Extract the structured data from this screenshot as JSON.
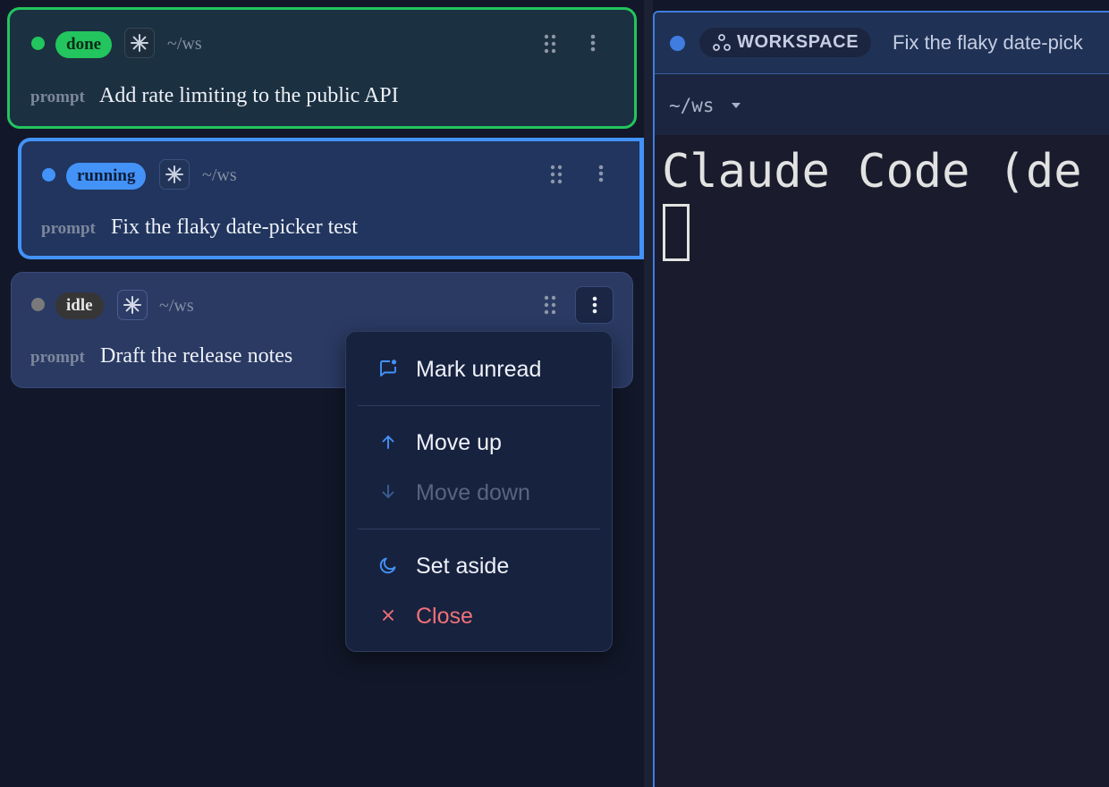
{
  "sessions": [
    {
      "status": "done",
      "path": "~/ws",
      "prompt_label": "prompt",
      "prompt": "Add rate limiting to the public API",
      "status_color": "#22c55e"
    },
    {
      "status": "running",
      "path": "~/ws",
      "prompt_label": "prompt",
      "prompt": "Fix the flaky date-picker test",
      "status_color": "#4392f7"
    },
    {
      "status": "idle",
      "path": "~/ws",
      "prompt_label": "prompt",
      "prompt": "Draft the release notes",
      "status_color": "#7a7a7a"
    }
  ],
  "workspace": {
    "chip_label": "WORKSPACE",
    "title": "Fix the flaky date-pick",
    "path": "~/ws",
    "terminal_text": "Claude Code (de",
    "accent": "#3f7de0"
  },
  "context_menu": {
    "items": [
      {
        "label": "Mark unread",
        "icon": "message-unread-icon",
        "enabled": true
      },
      {
        "label": "Move up",
        "icon": "arrow-up-icon",
        "enabled": true
      },
      {
        "label": "Move down",
        "icon": "arrow-down-icon",
        "enabled": false
      },
      {
        "label": "Set aside",
        "icon": "moon-icon",
        "enabled": true
      },
      {
        "label": "Close",
        "icon": "close-icon",
        "enabled": true,
        "danger": true
      }
    ],
    "danger_color": "#f07178",
    "icon_color": "#4392f7"
  }
}
